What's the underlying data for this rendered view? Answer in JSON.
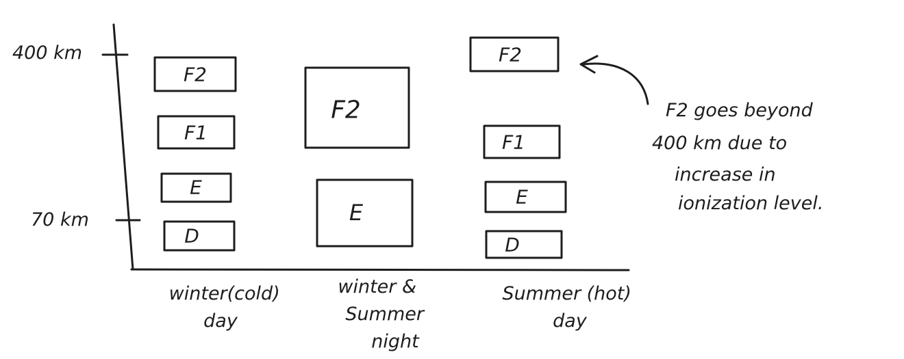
{
  "axis": {
    "tick_upper": "400 km",
    "tick_lower": "70 km"
  },
  "columns": [
    {
      "label_lines": [
        "winter(cold)",
        "day"
      ],
      "layers": [
        "F2",
        "F1",
        "E",
        "D"
      ]
    },
    {
      "label_lines": [
        "winter &",
        "Summer",
        "night"
      ],
      "layers": [
        "F2",
        "E"
      ]
    },
    {
      "label_lines": [
        "Summer (hot)",
        "day"
      ],
      "layers": [
        "F2",
        "F1",
        "E",
        "D"
      ]
    }
  ],
  "note": {
    "lines": [
      "F2 goes beyond",
      "400 km due to",
      "increase in",
      "ionization level."
    ]
  }
}
